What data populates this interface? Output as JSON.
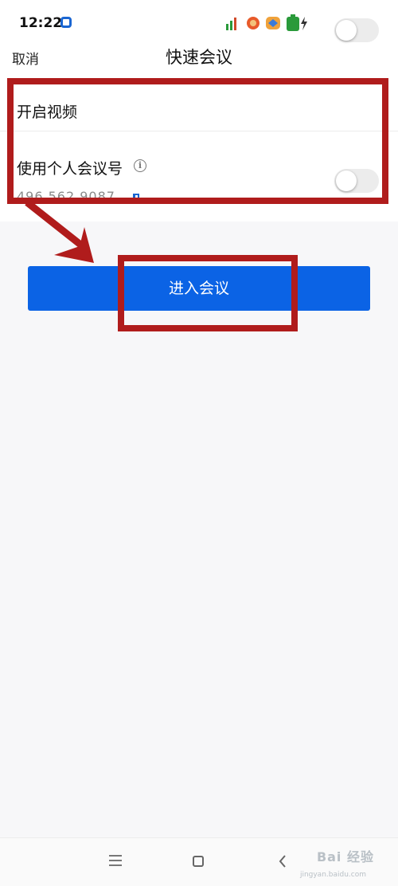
{
  "status_bar": {
    "time": "12:22"
  },
  "header": {
    "cancel_label": "取消",
    "title": "快速会议"
  },
  "settings": {
    "video": {
      "label": "开启视频",
      "enabled": false
    },
    "personal_meeting": {
      "label": "使用个人会议号",
      "meeting_id": "496 562 9087",
      "enabled": false
    }
  },
  "join_button_label": "进入会议",
  "colors": {
    "primary": "#0b63e5",
    "annotation": "#b01c1c"
  },
  "icons": {
    "info": "info-icon",
    "copy": "copy-icon",
    "nav_menu": "menu-icon",
    "nav_home": "home-icon",
    "nav_back": "back-icon"
  },
  "watermark": {
    "brand": "Bai 经验",
    "domain": "jingyan.baidu.com"
  }
}
